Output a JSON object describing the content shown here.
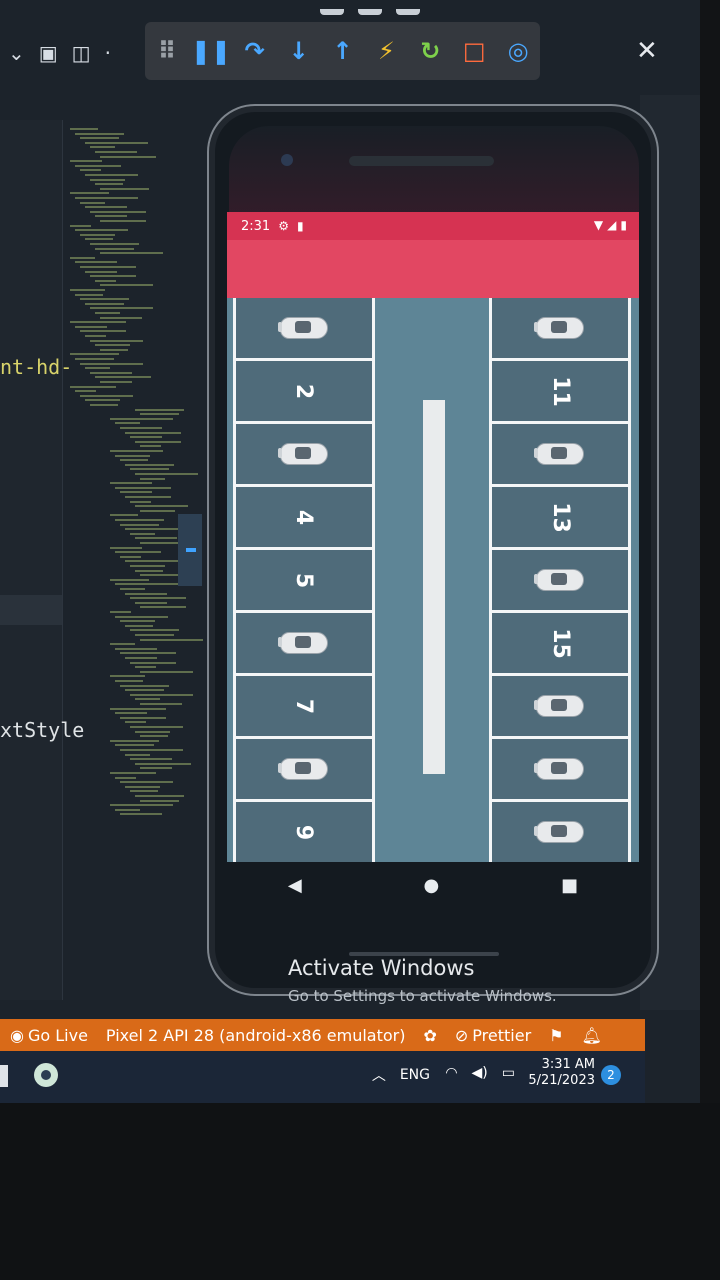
{
  "ide": {
    "code_fragment_1": "nt-hd-",
    "code_fragment_2": "xtStyle",
    "close_icon_glyph": "✕",
    "debug_icons": [
      {
        "glyph": "⠿",
        "color": "#9aa0a6",
        "name": "drag-handle-icon"
      },
      {
        "glyph": "❚❚",
        "color": "#4aa8ff",
        "name": "pause-icon"
      },
      {
        "glyph": "↷",
        "color": "#4aa8ff",
        "name": "step-over-icon"
      },
      {
        "glyph": "↓",
        "color": "#4aa8ff",
        "name": "step-into-icon"
      },
      {
        "glyph": "↑",
        "color": "#4aa8ff",
        "name": "step-out-icon"
      },
      {
        "glyph": "⚡",
        "color": "#f2c12e",
        "name": "hot-reload-icon"
      },
      {
        "glyph": "↻",
        "color": "#7ed04b",
        "name": "restart-icon"
      },
      {
        "glyph": "□",
        "color": "#ff6b3d",
        "name": "stop-icon"
      },
      {
        "glyph": "◎",
        "color": "#4aa8ff",
        "name": "devtools-icon"
      }
    ]
  },
  "phone": {
    "status": {
      "time": "2:31"
    },
    "left_column": [
      {
        "type": "car"
      },
      {
        "type": "num",
        "label": "2"
      },
      {
        "type": "car"
      },
      {
        "type": "num",
        "label": "4"
      },
      {
        "type": "num",
        "label": "5"
      },
      {
        "type": "car"
      },
      {
        "type": "num",
        "label": "7"
      },
      {
        "type": "car"
      },
      {
        "type": "num",
        "label": "9"
      }
    ],
    "right_column": [
      {
        "type": "car"
      },
      {
        "type": "num",
        "label": "11"
      },
      {
        "type": "car"
      },
      {
        "type": "num",
        "label": "13"
      },
      {
        "type": "car"
      },
      {
        "type": "num",
        "label": "15"
      },
      {
        "type": "car"
      },
      {
        "type": "car"
      },
      {
        "type": "car"
      }
    ],
    "nav": {
      "back": "◀",
      "home": "●",
      "recents": "■"
    }
  },
  "watermark": {
    "title": "Activate Windows",
    "subtitle": "Go to Settings to activate Windows."
  },
  "statusbar": {
    "go_live": "Go Live",
    "device": "Pixel 2 API 28 (android-x86 emulator)",
    "prettier": "Prettier"
  },
  "taskbar": {
    "language": "ENG",
    "time": "3:31 AM",
    "date": "5/21/2023",
    "notifications": "2"
  }
}
